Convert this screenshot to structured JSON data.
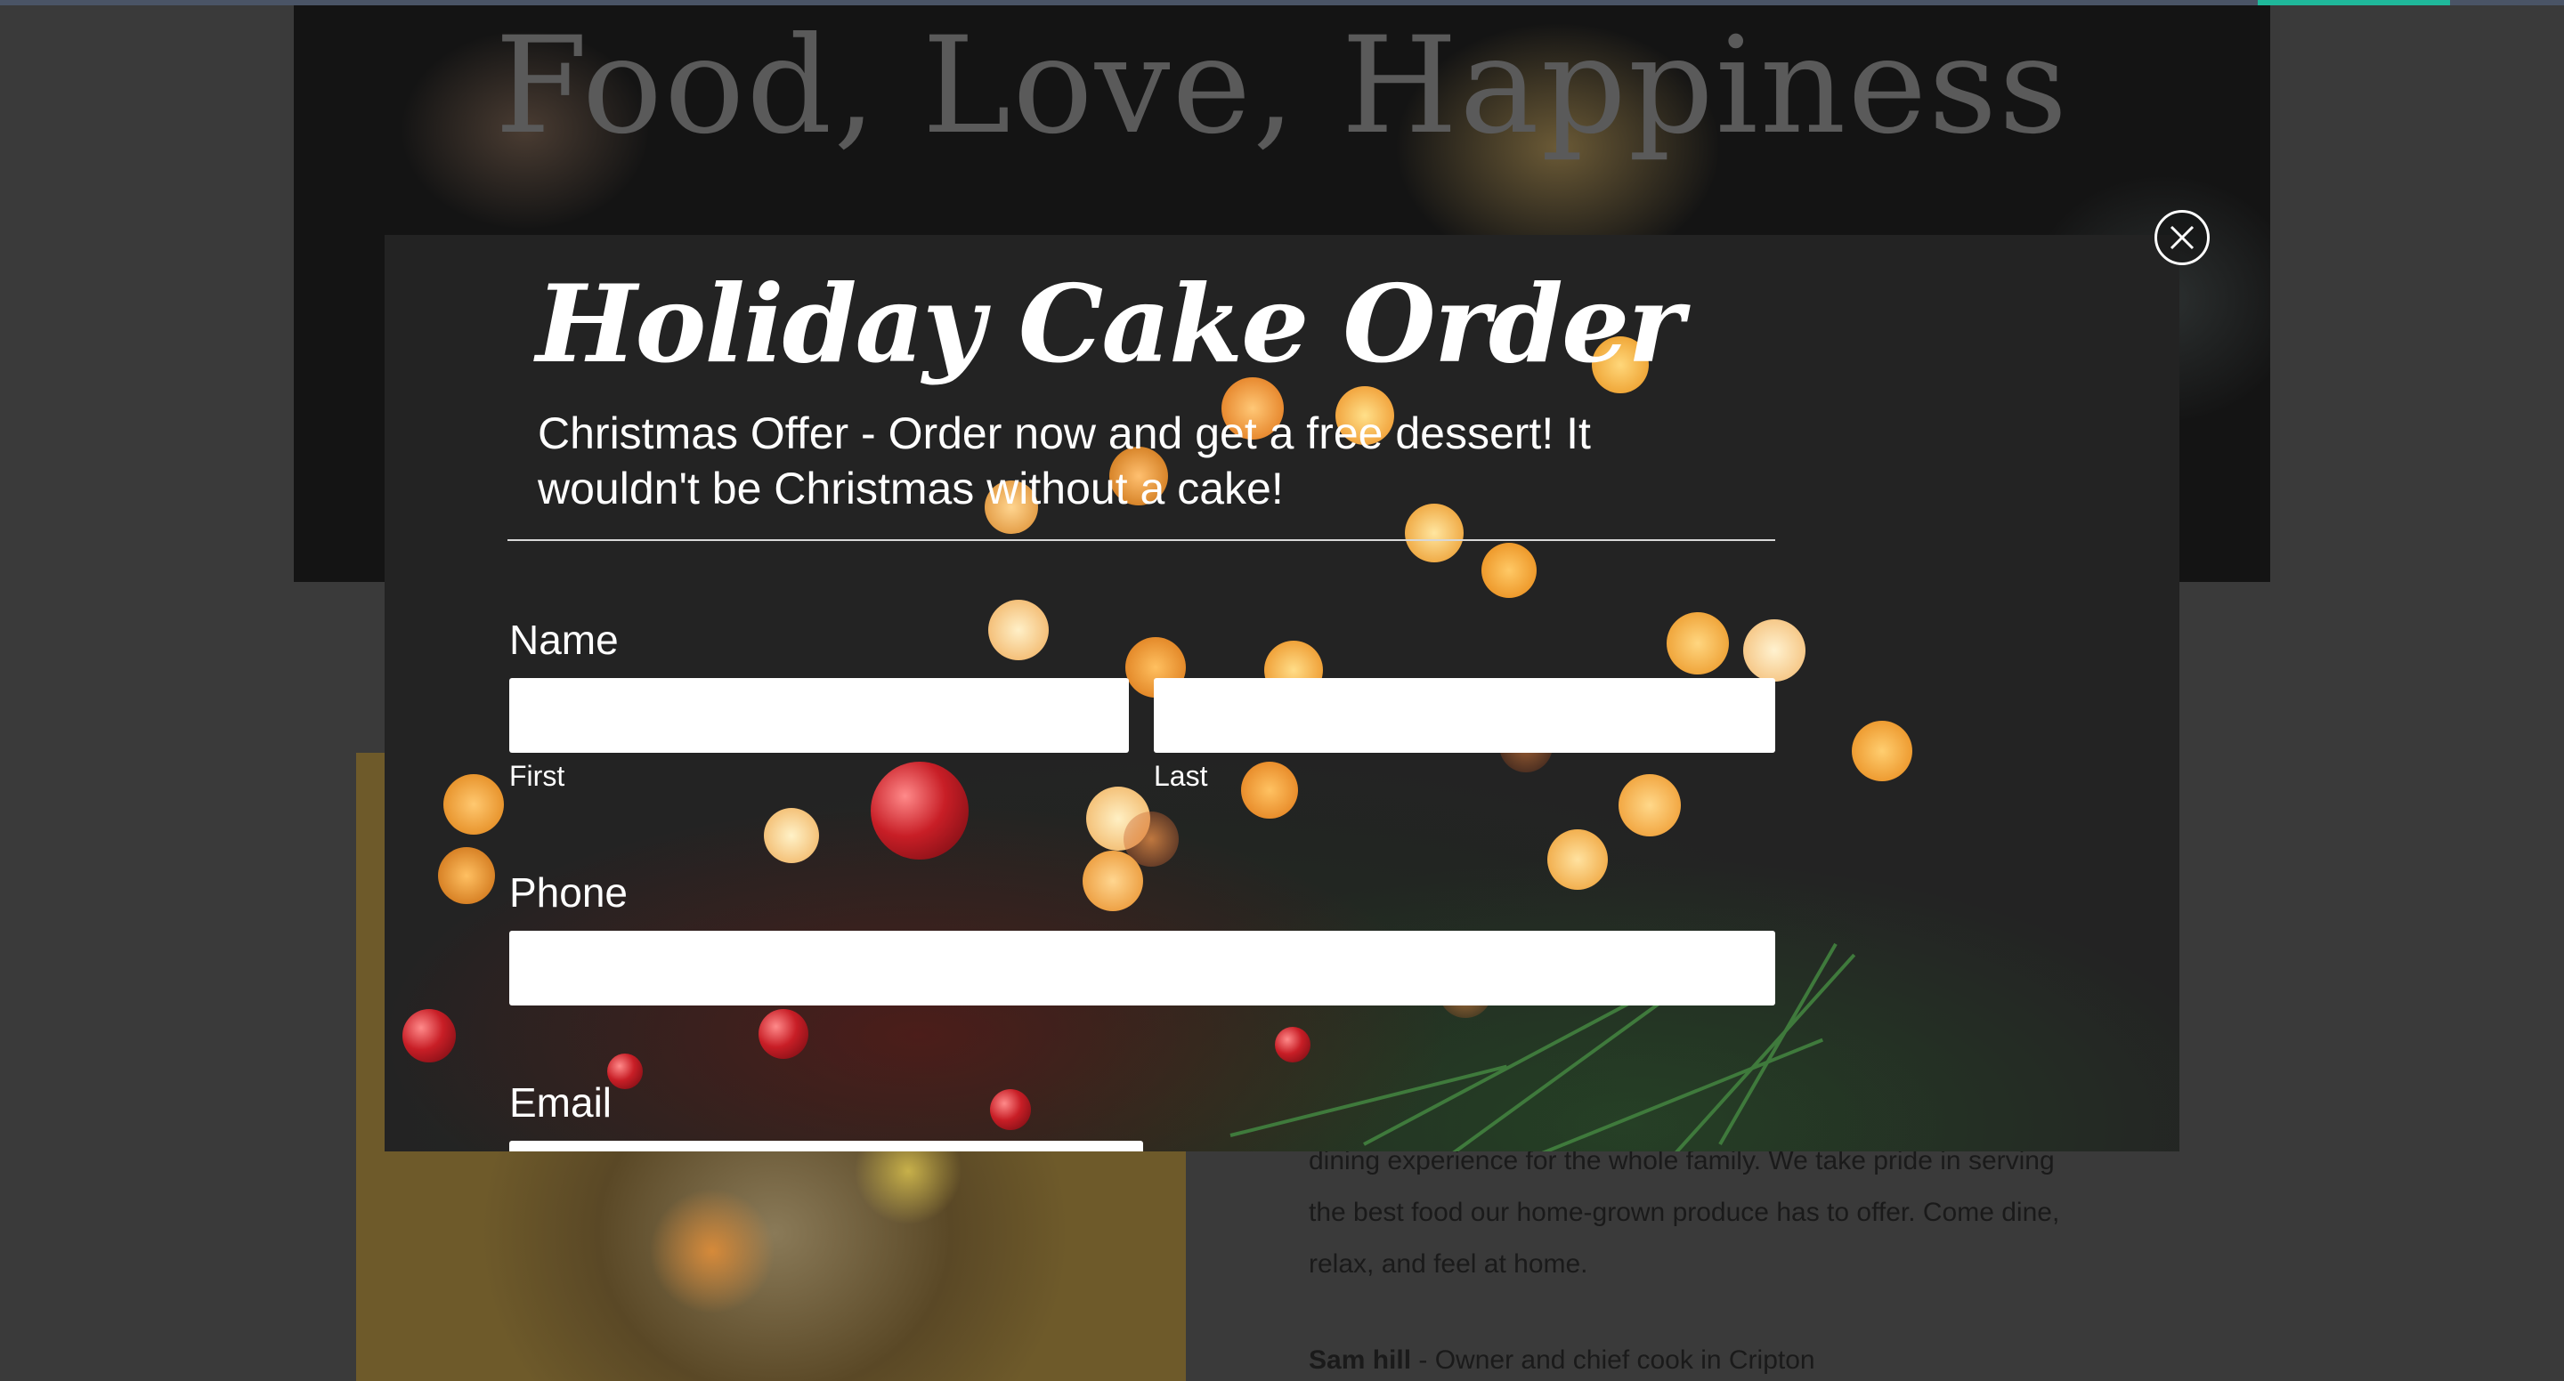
{
  "background_page": {
    "hero_title": "Food, Love, Happiness",
    "about_lines": [
      "dining experience for the whole family. We take pride in serving",
      "the best food our home-grown produce has to offer. Come dine,",
      "relax, and feel at home."
    ],
    "signature_name": "Sam hill",
    "signature_role": " - Owner and chief cook in Cripton"
  },
  "modal": {
    "title": "Holiday Cake Order",
    "subtitle": "Christmas Offer - Order now and get a free dessert! It wouldn't be Christmas without a cake!",
    "close_icon": "close-icon",
    "form": {
      "name_label": "Name",
      "first_sublabel": "First",
      "last_sublabel": "Last",
      "first_value": "",
      "last_value": "",
      "phone_label": "Phone",
      "phone_value": "",
      "email_label": "Email",
      "email_value": ""
    }
  },
  "colors": {
    "topbar": "#4a5466",
    "accent": "#1fb89a",
    "modal_bg": "#232323"
  }
}
